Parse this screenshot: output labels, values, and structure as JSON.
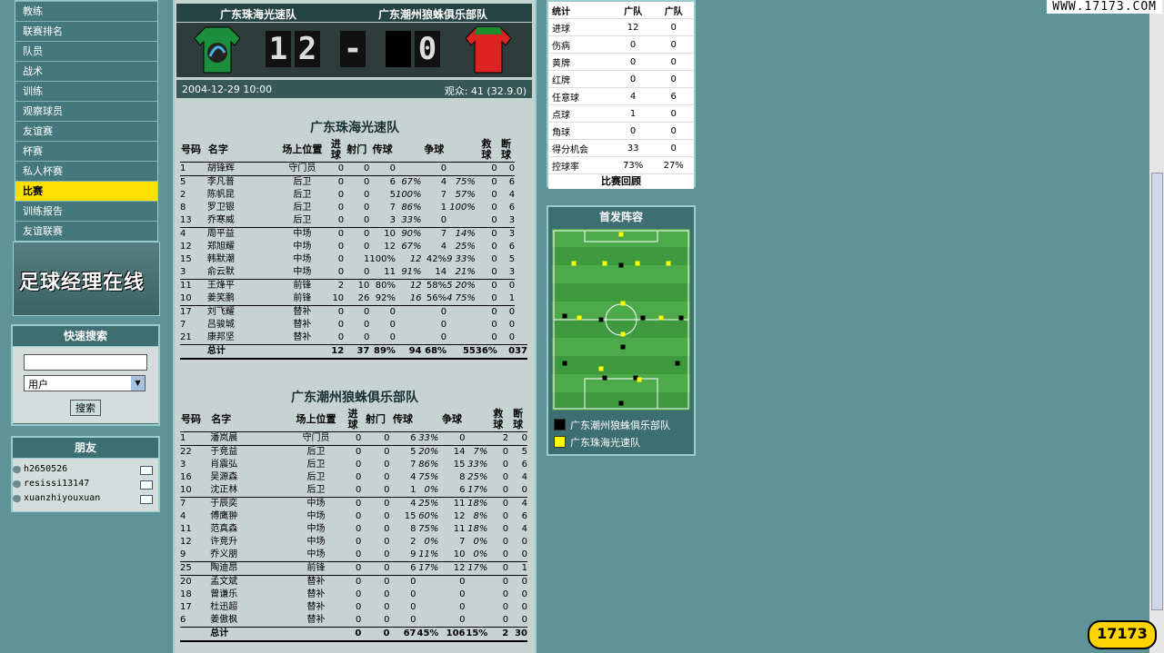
{
  "menu": [
    "教练",
    "联赛排名",
    "队员",
    "战术",
    "训练",
    "观察球员",
    "友谊赛",
    "杯赛",
    "私人杯赛",
    "比赛",
    "训练报告",
    "友谊联赛"
  ],
  "menu_active_index": 9,
  "logo_text": "足球经理在线",
  "search": {
    "title": "快速搜索",
    "select_value": "用户",
    "button": "搜索"
  },
  "friends": {
    "title": "朋友",
    "items": [
      "h2650526",
      "resissi13147",
      "xuanzhiyouxuan"
    ]
  },
  "match": {
    "home_team": "广东珠海光速队",
    "away_team": "广东潮州狼蛛俱乐部队",
    "home_score": "12",
    "away_score": "0",
    "dash": "-",
    "date": "2004-12-29 10:00",
    "attendance": "观众: 41 (32.9.0)"
  },
  "headers": {
    "home": [
      "号码",
      "名字",
      "场上位置",
      "进球",
      "射门",
      "传球",
      "",
      "争球",
      "",
      "救球",
      "断球"
    ],
    "away": [
      "号码",
      "名字",
      "场上位置",
      "进球",
      "射门",
      "传球",
      "",
      "争球",
      "",
      "救球",
      "断球"
    ]
  },
  "home_rows": [
    [
      "1",
      "胡锋辉",
      "守门员",
      "0",
      "0",
      "0",
      "",
      "0",
      "",
      "0",
      "0"
    ],
    [
      "5",
      "李凡普",
      "后卫",
      "0",
      "0",
      "6",
      "67%",
      "4",
      "75%",
      "0",
      "6"
    ],
    [
      "2",
      "陈帆昆",
      "后卫",
      "0",
      "0",
      "5",
      "100%",
      "7",
      "57%",
      "0",
      "4"
    ],
    [
      "8",
      "罗卫银",
      "后卫",
      "0",
      "0",
      "7",
      "86%",
      "1",
      "100%",
      "0",
      "6"
    ],
    [
      "13",
      "乔寒威",
      "后卫",
      "0",
      "0",
      "3",
      "33%",
      "0",
      "",
      "0",
      "3"
    ],
    [
      "4",
      "周平益",
      "中场",
      "0",
      "0",
      "10",
      "90%",
      "7",
      "14%",
      "0",
      "3"
    ],
    [
      "12",
      "郑旭耀",
      "中场",
      "0",
      "0",
      "12",
      "67%",
      "4",
      "25%",
      "0",
      "6"
    ],
    [
      "15",
      "韩默潮",
      "中场",
      "0",
      "1",
      "100%",
      "12",
      "42%",
      "9 33%",
      "0",
      "5"
    ],
    [
      "3",
      "俞云默",
      "中场",
      "0",
      "0",
      "11",
      "91%",
      "14",
      "21%",
      "0",
      "3"
    ],
    [
      "11",
      "王烽平",
      "前锋",
      "2",
      "10",
      "80%",
      "12",
      "58%",
      "5 20%",
      "0",
      "0"
    ],
    [
      "10",
      "姜笑鹏",
      "前锋",
      "10",
      "26",
      "92%",
      "16",
      "56%",
      "4 75%",
      "0",
      "1"
    ],
    [
      "17",
      "刘飞耀",
      "替补",
      "0",
      "0",
      "0",
      "",
      "0",
      "",
      "0",
      "0"
    ],
    [
      "7",
      "吕骏城",
      "替补",
      "0",
      "0",
      "0",
      "",
      "0",
      "",
      "0",
      "0"
    ],
    [
      "21",
      "康邦坚",
      "替补",
      "0",
      "0",
      "0",
      "",
      "0",
      "",
      "0",
      "0"
    ]
  ],
  "home_total": [
    "总计",
    "12",
    "37",
    "89%",
    "94",
    "68%",
    "55",
    "36%",
    "0",
    "37"
  ],
  "away_rows": [
    [
      "1",
      "潘岚晨",
      "守门员",
      "0",
      "0",
      "6",
      "33%",
      "0",
      "",
      "2",
      "0"
    ],
    [
      "22",
      "于竞益",
      "后卫",
      "0",
      "0",
      "5",
      "20%",
      "14",
      "7%",
      "0",
      "5"
    ],
    [
      "3",
      "肖震弘",
      "后卫",
      "0",
      "0",
      "7",
      "86%",
      "15",
      "33%",
      "0",
      "6"
    ],
    [
      "16",
      "吴源森",
      "后卫",
      "0",
      "0",
      "4",
      "75%",
      "8",
      "25%",
      "0",
      "4"
    ],
    [
      "10",
      "沈正林",
      "后卫",
      "0",
      "0",
      "1",
      "0%",
      "6",
      "17%",
      "0",
      "0"
    ],
    [
      "7",
      "于辰奕",
      "中场",
      "0",
      "0",
      "4",
      "25%",
      "11",
      "18%",
      "0",
      "4"
    ],
    [
      "4",
      "傅鹰翀",
      "中场",
      "0",
      "0",
      "15",
      "60%",
      "12",
      "8%",
      "0",
      "6"
    ],
    [
      "11",
      "范真森",
      "中场",
      "0",
      "0",
      "8",
      "75%",
      "11",
      "18%",
      "0",
      "4"
    ],
    [
      "12",
      "许竞升",
      "中场",
      "0",
      "0",
      "2",
      "0%",
      "7",
      "0%",
      "0",
      "0"
    ],
    [
      "9",
      "乔义朋",
      "中场",
      "0",
      "0",
      "9",
      "11%",
      "10",
      "0%",
      "0",
      "0"
    ],
    [
      "25",
      "陶迪昂",
      "前锋",
      "0",
      "0",
      "6",
      "17%",
      "12",
      "17%",
      "0",
      "1"
    ],
    [
      "20",
      "孟文斌",
      "替补",
      "0",
      "0",
      "0",
      "",
      "0",
      "",
      "0",
      "0"
    ],
    [
      "18",
      "曾谦乐",
      "替补",
      "0",
      "0",
      "0",
      "",
      "0",
      "",
      "0",
      "0"
    ],
    [
      "17",
      "杜迅超",
      "替补",
      "0",
      "0",
      "0",
      "",
      "0",
      "",
      "0",
      "0"
    ],
    [
      "6",
      "姜傲枫",
      "替补",
      "0",
      "0",
      "0",
      "",
      "0",
      "",
      "0",
      "0"
    ]
  ],
  "away_total": [
    "总计",
    "0",
    "0",
    "67",
    "45%",
    "106",
    "15%",
    "2",
    "30"
  ],
  "stats": {
    "header": [
      "统计",
      "广队",
      "广队"
    ],
    "rows": [
      [
        "进球",
        "12",
        "0"
      ],
      [
        "伤病",
        "0",
        "0"
      ],
      [
        "黄牌",
        "0",
        "0"
      ],
      [
        "红牌",
        "0",
        "0"
      ],
      [
        "任意球",
        "4",
        "6"
      ],
      [
        "点球",
        "1",
        "0"
      ],
      [
        "角球",
        "0",
        "0"
      ],
      [
        "得分机会",
        "33",
        "0"
      ],
      [
        "控球率",
        "73%",
        "27%"
      ]
    ],
    "review": "比赛回顾"
  },
  "lineup": {
    "title": "首发阵容",
    "legend_black": "广东潮州狼蛛俱乐部队",
    "legend_yellow": "广东珠海光速队",
    "colors": {
      "black": "#000000",
      "yellow": "#ffff00",
      "pitch": "#3f9a3f"
    }
  },
  "watermark": "WWW.17173.COM",
  "brand": "17173"
}
